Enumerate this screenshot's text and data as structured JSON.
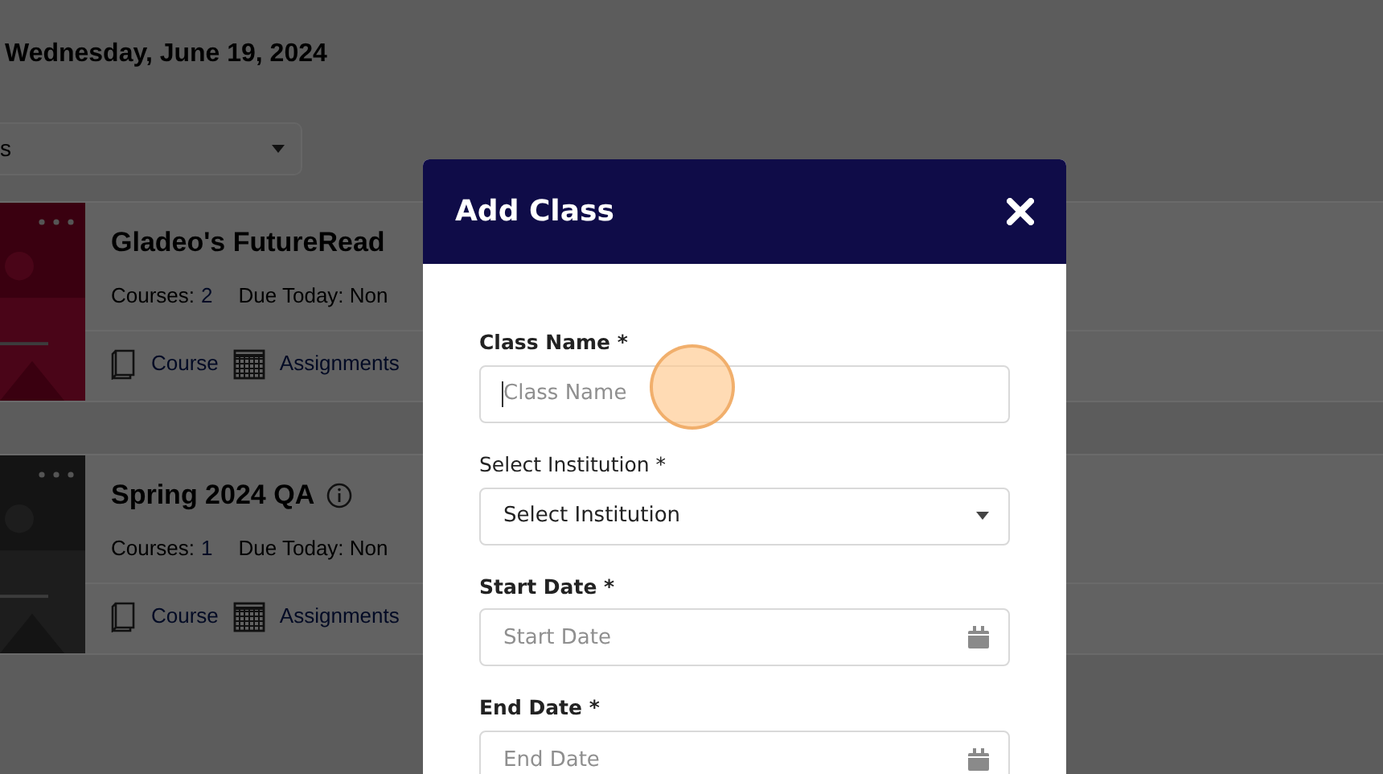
{
  "page": {
    "date": "Wednesday, June 19, 2024",
    "filter": {
      "value": "s"
    }
  },
  "classes": [
    {
      "title": "Gladeo's FutureRead",
      "info_icon": false,
      "courses_label": "Courses:",
      "courses_count": "2",
      "due": "Due Today: Non",
      "links": [
        "Course",
        "Assignments"
      ]
    },
    {
      "title": "Spring 2024 QA",
      "info_icon": true,
      "courses_label": "Courses:",
      "courses_count": "1",
      "due": "Due Today: Non",
      "links": [
        "Course",
        "Assignments"
      ]
    }
  ],
  "modal": {
    "title": "Add Class",
    "fields": [
      {
        "label": "Class Name *",
        "bold": true,
        "kind": "text",
        "placeholder": "Class Name",
        "focused": true
      },
      {
        "label": "Select Institution *",
        "bold": false,
        "kind": "select",
        "value": "Select Institution"
      },
      {
        "label": "Start Date *",
        "bold": true,
        "kind": "date",
        "placeholder": "Start Date",
        "focused": false
      },
      {
        "label": "End Date *",
        "bold": true,
        "kind": "date",
        "placeholder": "End Date",
        "focused": false
      }
    ]
  }
}
